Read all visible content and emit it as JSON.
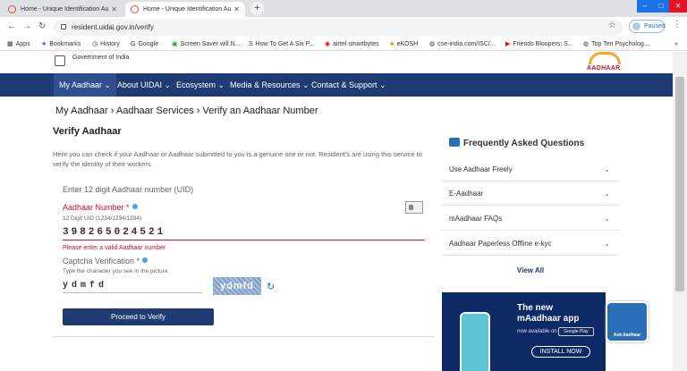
{
  "browser": {
    "tabs": [
      {
        "label": "Home - Unique Identification Au"
      },
      {
        "label": "Home - Unique Identification Au"
      }
    ],
    "url": "resident.uidai.gov.in/verify",
    "profile_label": "Paused",
    "bookmarks": [
      {
        "label": "Apps"
      },
      {
        "label": "Bookmarks"
      },
      {
        "label": "History"
      },
      {
        "label": "Google"
      },
      {
        "label": "Screen Saver will N..."
      },
      {
        "label": "How To Get A Six P..."
      },
      {
        "label": "airtel smartbytes"
      },
      {
        "label": "eKOSH"
      },
      {
        "label": "cse-india.com/ISC/..."
      },
      {
        "label": "Friends Bloopers: S..."
      },
      {
        "label": "Top Ten Psycholog..."
      }
    ]
  },
  "header": {
    "gov_label": "Government of India",
    "logo_text": "AADHAAR"
  },
  "nav": {
    "items": [
      {
        "label": "My Aadhaar ⌄"
      },
      {
        "label": "About UIDAI ⌄"
      },
      {
        "label": "Ecosystem ⌄"
      },
      {
        "label": "Media & Resources ⌄"
      },
      {
        "label": "Contact & Support ⌄"
      }
    ]
  },
  "breadcrumb": "My Aadhaar  ›  Aadhaar Services  ›  Verify an Aadhaar Number",
  "page_title": "Verify Aadhaar",
  "description": "Here you can check if your Aadhaar or Aadhaar submitted to you is a genuine one or not. Resident's are using this service to verify the identity of their workers.",
  "form": {
    "heading": "Enter 12 digit Aadhaar number (UID)",
    "uid_label": "Aadhaar Number *",
    "uid_hint": "12 Digit UID (1234/1234/1234)",
    "uid_value": "398265024521",
    "uid_error": "Please enter a valid Aadhaar number",
    "captcha_label": "Captcha Verification *",
    "captcha_hint": "Type the character you see in the picture.",
    "captcha_value": "ydmfd",
    "captcha_image_text": "ydmfd",
    "submit_label": "Proceed to Verify"
  },
  "faq": {
    "title": "Frequently Asked Questions",
    "items": [
      {
        "label": "Use Aadhaar Freely"
      },
      {
        "label": "E-Aadhaar"
      },
      {
        "label": "mAadhaar FAQs"
      },
      {
        "label": "Aadhaar Paperless Offline e-kyc"
      }
    ],
    "view_all": "View All"
  },
  "promo": {
    "headline_1": "The new",
    "headline_2": "mAadhaar app",
    "available": "now available on",
    "store": "Google Play",
    "install": "INSTALL NOW"
  },
  "ask_aadhaar": "Ask Aadhaar",
  "colors": {
    "nav": "#1f3b73",
    "error": "#c8102e",
    "accent": "#2a6fb8"
  }
}
